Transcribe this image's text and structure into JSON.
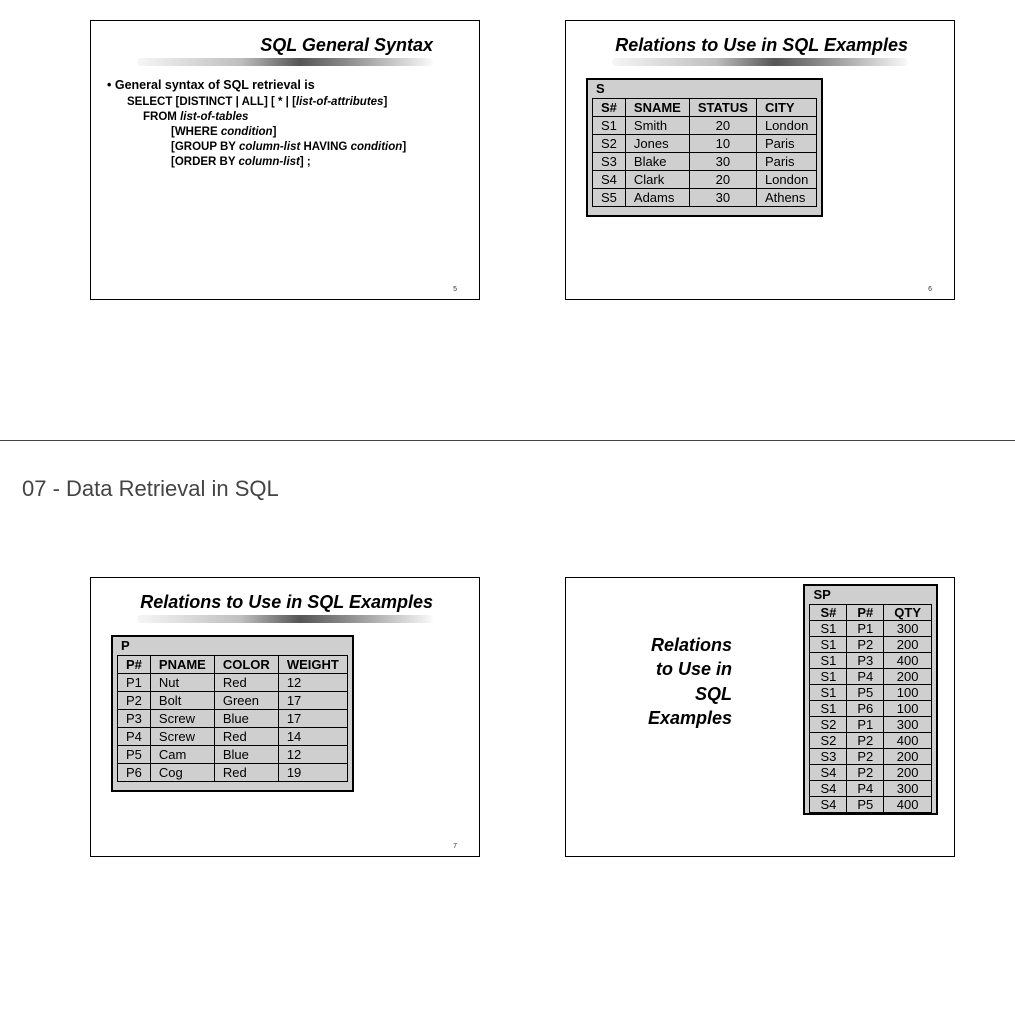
{
  "section_heading": "07 - Data Retrieval in SQL",
  "slide5": {
    "title": "SQL General Syntax",
    "bullet": "General syntax of SQL retrieval is",
    "l1a": "SELECT [DISTINCT | ALL] [ * | [",
    "l1b": "list-of-attributes",
    "l1c": "]",
    "l2a": "FROM ",
    "l2b": "list-of-tables",
    "l3a": "[WHERE ",
    "l3b": "condition",
    "l3c": "]",
    "l4a": "[GROUP BY ",
    "l4b": "column-list",
    "l4c": " HAVING ",
    "l4d": "condition",
    "l4e": "]",
    "l5a": "[ORDER BY ",
    "l5b": "column-list",
    "l5c": "] ;",
    "page": "5"
  },
  "slide6": {
    "title": "Relations to Use in SQL Examples",
    "label": "S",
    "headers": [
      "S#",
      "SNAME",
      "STATUS",
      "CITY"
    ],
    "rows": [
      [
        "S1",
        "Smith",
        "20",
        "London"
      ],
      [
        "S2",
        "Jones",
        "10",
        "Paris"
      ],
      [
        "S3",
        "Blake",
        "30",
        "Paris"
      ],
      [
        "S4",
        "Clark",
        "20",
        "London"
      ],
      [
        "S5",
        "Adams",
        "30",
        "Athens"
      ]
    ],
    "page": "6"
  },
  "slide7": {
    "title": "Relations to Use in SQL Examples",
    "label": "P",
    "headers": [
      "P#",
      "PNAME",
      "COLOR",
      "WEIGHT"
    ],
    "rows": [
      [
        "P1",
        "Nut",
        "Red",
        "12"
      ],
      [
        "P2",
        "Bolt",
        "Green",
        "17"
      ],
      [
        "P3",
        "Screw",
        "Blue",
        "17"
      ],
      [
        "P4",
        "Screw",
        "Red",
        "14"
      ],
      [
        "P5",
        "Cam",
        "Blue",
        "12"
      ],
      [
        "P6",
        "Cog",
        "Red",
        "19"
      ]
    ],
    "page": "7"
  },
  "slide8": {
    "title_lines": [
      "Relations",
      "to Use in",
      "SQL",
      "Examples"
    ],
    "label": "SP",
    "headers": [
      "S#",
      "P#",
      "QTY"
    ],
    "rows": [
      [
        "S1",
        "P1",
        "300"
      ],
      [
        "S1",
        "P2",
        "200"
      ],
      [
        "S1",
        "P3",
        "400"
      ],
      [
        "S1",
        "P4",
        "200"
      ],
      [
        "S1",
        "P5",
        "100"
      ],
      [
        "S1",
        "P6",
        "100"
      ],
      [
        "S2",
        "P1",
        "300"
      ],
      [
        "S2",
        "P2",
        "400"
      ],
      [
        "S3",
        "P2",
        "200"
      ],
      [
        "S4",
        "P2",
        "200"
      ],
      [
        "S4",
        "P4",
        "300"
      ],
      [
        "S4",
        "P5",
        "400"
      ]
    ]
  }
}
